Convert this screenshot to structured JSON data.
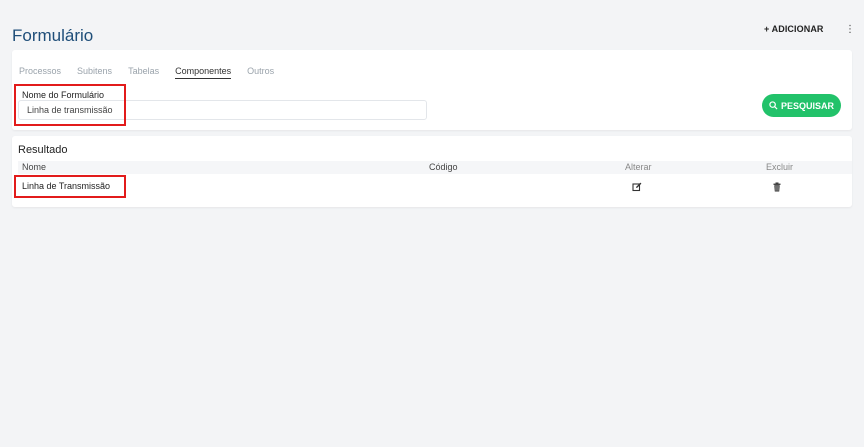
{
  "header": {
    "title": "Formulário",
    "add_label": "+ ADICIONAR",
    "more_icon": "⋮"
  },
  "tabs": [
    {
      "label": "Processos",
      "active": false
    },
    {
      "label": "Subitens",
      "active": false
    },
    {
      "label": "Tabelas",
      "active": false
    },
    {
      "label": "Componentes",
      "active": true
    },
    {
      "label": "Outros",
      "active": false
    }
  ],
  "search": {
    "field_label": "Nome do Formulário",
    "field_value": "Linha de transmissão",
    "button_label": "PESQUISAR",
    "button_icon": "search-icon"
  },
  "result": {
    "title": "Resultado",
    "columns": [
      "Nome",
      "Código",
      "Alterar",
      "Excluir"
    ],
    "rows": [
      {
        "nome": "Linha de Transmissão",
        "codigo": "",
        "alterar_icon": "edit-icon",
        "excluir_icon": "trash-icon"
      }
    ]
  },
  "colors": {
    "title": "#1f4e79",
    "accent_green": "#22c26a",
    "highlight_red": "#e21b1b"
  }
}
